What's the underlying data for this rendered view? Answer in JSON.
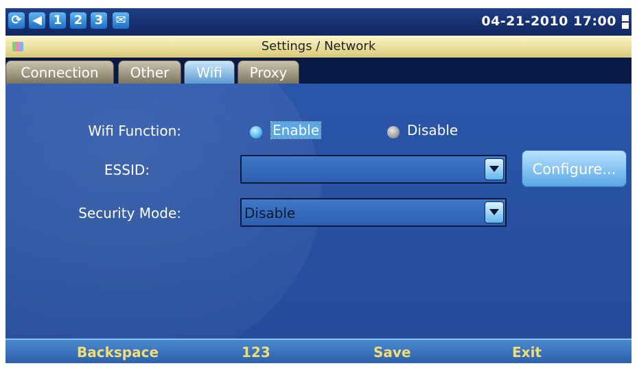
{
  "status_bar": {
    "icons": [
      {
        "name": "network-icon",
        "glyph": "⟳"
      },
      {
        "name": "volume-icon",
        "glyph": "◀"
      },
      {
        "name": "line1-icon",
        "glyph": "1"
      },
      {
        "name": "line2-icon",
        "glyph": "2"
      },
      {
        "name": "line3-icon",
        "glyph": "3"
      },
      {
        "name": "message-icon",
        "glyph": "✉"
      }
    ],
    "datetime": "04-21-2010 17:00"
  },
  "header": {
    "title": "Settings / Network"
  },
  "tabs": [
    {
      "label": "Connection",
      "active": false
    },
    {
      "label": "Other",
      "active": false
    },
    {
      "label": "Wifi",
      "active": true
    },
    {
      "label": "Proxy",
      "active": false
    }
  ],
  "form": {
    "wifi_function": {
      "label": "Wifi Function:",
      "options": [
        "Enable",
        "Disable"
      ],
      "selected": "Enable"
    },
    "essid": {
      "label": "ESSID:",
      "value": ""
    },
    "security_mode": {
      "label": "Security Mode:",
      "value": "Disable"
    },
    "configure_label": "Configure..."
  },
  "softkeys": [
    "Backspace",
    "123",
    "Save",
    "Exit"
  ]
}
